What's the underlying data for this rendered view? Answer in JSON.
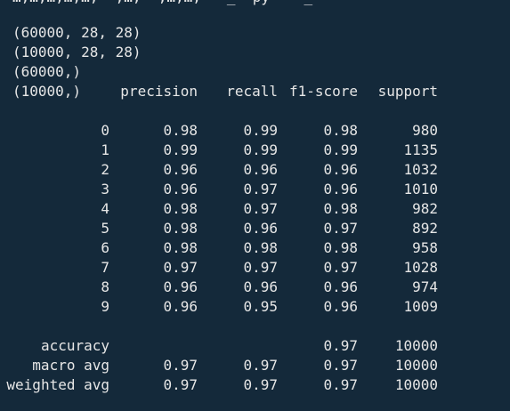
{
  "output": {
    "cut_line": "…,…,…,…,…;  ,…,  ,…,…,   _  py    _",
    "shapes": [
      "(60000, 28, 28)",
      "(10000, 28, 28)",
      "(60000,)",
      "(10000,)"
    ],
    "report": {
      "headers": [
        "precision",
        "recall",
        "f1-score",
        "support"
      ],
      "rows": [
        {
          "label": "0",
          "precision": "0.98",
          "recall": "0.99",
          "f1": "0.98",
          "support": "980"
        },
        {
          "label": "1",
          "precision": "0.99",
          "recall": "0.99",
          "f1": "0.99",
          "support": "1135"
        },
        {
          "label": "2",
          "precision": "0.96",
          "recall": "0.96",
          "f1": "0.96",
          "support": "1032"
        },
        {
          "label": "3",
          "precision": "0.96",
          "recall": "0.97",
          "f1": "0.96",
          "support": "1010"
        },
        {
          "label": "4",
          "precision": "0.98",
          "recall": "0.97",
          "f1": "0.98",
          "support": "982"
        },
        {
          "label": "5",
          "precision": "0.98",
          "recall": "0.96",
          "f1": "0.97",
          "support": "892"
        },
        {
          "label": "6",
          "precision": "0.98",
          "recall": "0.98",
          "f1": "0.98",
          "support": "958"
        },
        {
          "label": "7",
          "precision": "0.97",
          "recall": "0.97",
          "f1": "0.97",
          "support": "1028"
        },
        {
          "label": "8",
          "precision": "0.96",
          "recall": "0.96",
          "f1": "0.96",
          "support": "974"
        },
        {
          "label": "9",
          "precision": "0.96",
          "recall": "0.95",
          "f1": "0.96",
          "support": "1009"
        }
      ],
      "summary": [
        {
          "label": "accuracy",
          "precision": "",
          "recall": "",
          "f1": "0.97",
          "support": "10000"
        },
        {
          "label": "macro avg",
          "precision": "0.97",
          "recall": "0.97",
          "f1": "0.97",
          "support": "10000"
        },
        {
          "label": "weighted avg",
          "precision": "0.97",
          "recall": "0.97",
          "f1": "0.97",
          "support": "10000"
        }
      ]
    }
  },
  "colors": {
    "background": "#14293a",
    "text": "#e6e6e6",
    "highlight": "#d6a53a"
  }
}
